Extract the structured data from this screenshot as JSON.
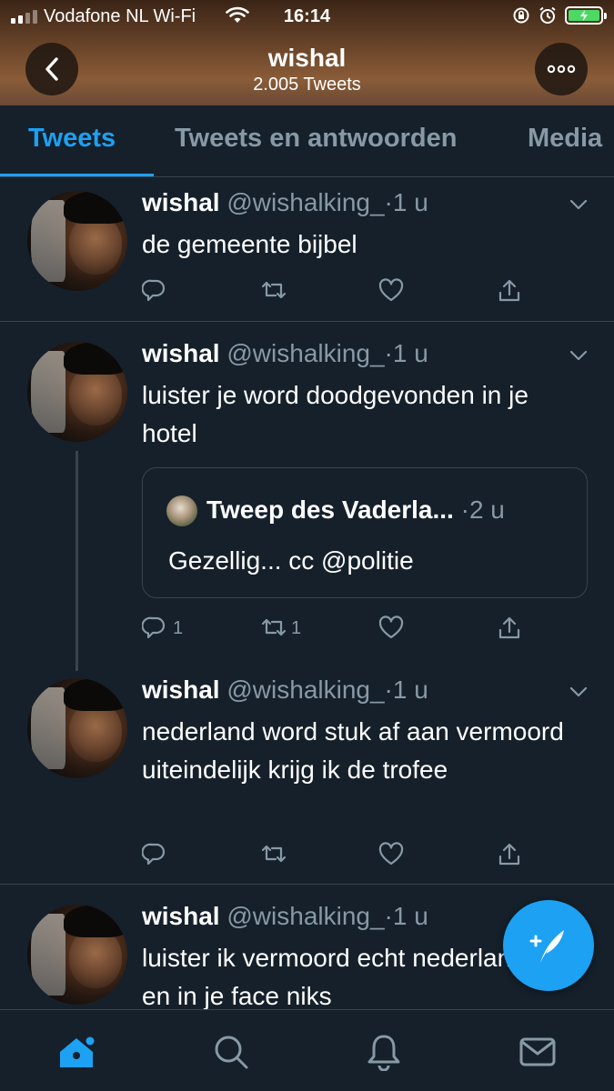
{
  "status_bar": {
    "carrier": "Vodafone NL Wi-Fi",
    "time": "16:14"
  },
  "profile": {
    "name": "wishal",
    "tweet_count": "2.005 Tweets"
  },
  "tabs": [
    {
      "label": "Tweets",
      "active": true
    },
    {
      "label": "Tweets en antwoorden",
      "active": false
    },
    {
      "label": "Media",
      "active": false
    }
  ],
  "tweets": [
    {
      "name": "wishal",
      "handle": "@wishalking_",
      "dot": "·",
      "time": "1 u",
      "text": "de gemeente bijbel",
      "reply_count": "",
      "retweet_count": ""
    },
    {
      "name": "wishal",
      "handle": "@wishalking_",
      "dot": "·",
      "time": "1 u",
      "text": "luister je word doodgevonden in je hotel",
      "quote": {
        "name": "Tweep des Vaderla...",
        "dot": "·",
        "time": "2 u",
        "text": "Gezellig... cc @politie"
      },
      "reply_count": "1",
      "retweet_count": "1"
    },
    {
      "name": "wishal",
      "handle": "@wishalking_",
      "dot": "·",
      "time": "1 u",
      "text": "nederland word stuk af aan vermoord uiteindelijk krijg ik de trofee",
      "reply_count": "",
      "retweet_count": ""
    },
    {
      "name": "wishal",
      "handle": "@wishalking_",
      "dot": "·",
      "time": "1 u",
      "text": "luister ik vermoord echt nederlanders en in je face niks"
    }
  ],
  "icons": {
    "back": "chevron-left-icon",
    "more": "more-horizontal-icon",
    "reply": "reply-icon",
    "retweet": "retweet-icon",
    "like": "heart-icon",
    "share": "share-icon",
    "compose": "compose-tweet-icon",
    "nav": [
      "home-icon",
      "search-icon",
      "notifications-icon",
      "messages-icon"
    ]
  },
  "colors": {
    "background": "#15202b",
    "accent": "#1da1f2",
    "secondary_text": "#8899a6",
    "divider": "#38444d"
  }
}
